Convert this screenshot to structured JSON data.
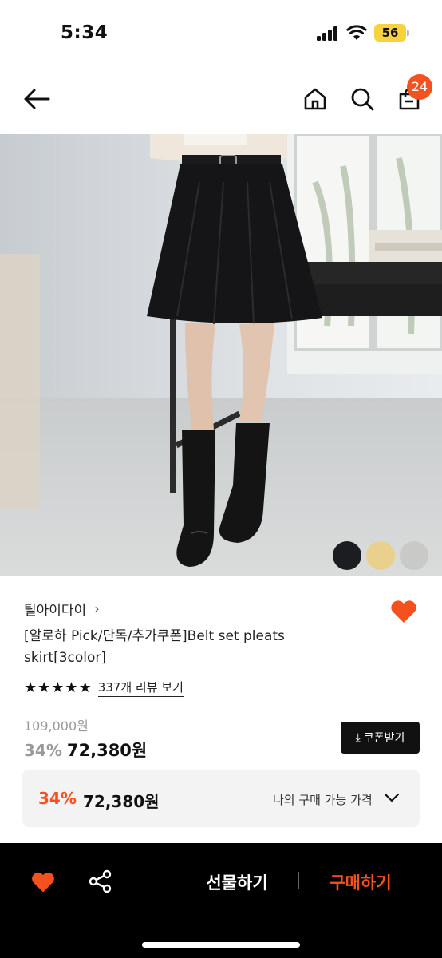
{
  "status_bar": {
    "time": "5:34",
    "battery": "56"
  },
  "header": {
    "cart_count": "24"
  },
  "product": {
    "brand": "틸아이다이",
    "title": "[알로하 Pick/단독/추가쿠폰]Belt set pleats skirt[3color]",
    "rating_stars": 5,
    "review_link": "337개 리뷰 보기",
    "original_price": "109,000원",
    "discount": "34%",
    "price": "72,380원",
    "coupon_button": "쿠폰받기",
    "swatch_colors": [
      "#1b1d21",
      "#e9d08c",
      "#c9c9c7"
    ]
  },
  "my_price": {
    "discount": "34%",
    "price": "72,380원",
    "label": "나의 구매 가능 가격"
  },
  "bottom_bar": {
    "gift_label": "선물하기",
    "buy_label": "구매하기"
  },
  "colors": {
    "accent": "#f4511e"
  }
}
